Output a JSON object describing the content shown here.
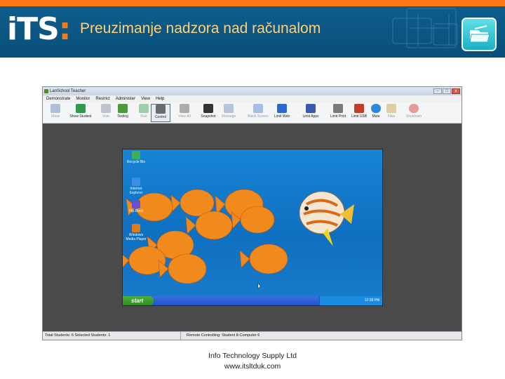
{
  "header": {
    "logo_text": "iTS",
    "logo_colon": ":",
    "title": "Preuzimanje nadzora nad računalom",
    "accent_color": "#ff7a14",
    "band_color": "#0d5f8f",
    "title_color": "#ffd27a",
    "corner_icon": "folder-icon"
  },
  "window": {
    "title": "LanSchool Teacher",
    "buttons": {
      "minimize": "–",
      "maximize": "□",
      "close": "x"
    },
    "menu": [
      "Demonstrate",
      "Monitor",
      "Restrict",
      "Administer",
      "View",
      "Help"
    ],
    "toolbar": [
      {
        "label": "Show",
        "icon": "monitor-icon",
        "enabled": false
      },
      {
        "label": "Show Student",
        "icon": "student-icon",
        "enabled": true
      },
      {
        "label": "Vote",
        "icon": "vote-icon",
        "enabled": false
      },
      {
        "label": "Testing",
        "icon": "testing-icon",
        "enabled": true
      },
      {
        "label": "Run",
        "icon": "run-icon",
        "enabled": false
      },
      {
        "label": "Control",
        "icon": "pen-icon",
        "enabled": true,
        "selected": true
      },
      {
        "label": "View All",
        "icon": "grid-icon",
        "enabled": false
      },
      {
        "label": "Snapshot",
        "icon": "camera-icon",
        "enabled": true
      },
      {
        "label": "Message",
        "icon": "message-icon",
        "enabled": false
      },
      {
        "label": "Blank Screen",
        "icon": "blank-screen-icon",
        "enabled": false
      },
      {
        "label": "Limit Web",
        "icon": "web-icon",
        "enabled": true
      },
      {
        "label": "Limit Apps",
        "icon": "apps-icon",
        "enabled": true
      },
      {
        "label": "Limit Print",
        "icon": "printer-icon",
        "enabled": true
      },
      {
        "label": "Limit USB",
        "icon": "usb-icon",
        "enabled": true
      },
      {
        "label": "Mute",
        "icon": "speaker-icon",
        "enabled": true
      },
      {
        "label": "Files",
        "icon": "files-icon",
        "enabled": false
      },
      {
        "label": "Shutdown",
        "icon": "shutdown-icon",
        "enabled": false
      }
    ],
    "status": {
      "left": "Total Students: 6  Selected Students: 1",
      "right": "Remote Controlling: Student 8-Computer 6"
    }
  },
  "desktop": {
    "icons": [
      {
        "label": "Recycle Bin",
        "icon": "recycle-bin-icon",
        "color": "#3fae5a"
      },
      {
        "label": "Internet Explorer",
        "icon": "internet-explorer-icon",
        "color": "#3a8ee6"
      },
      {
        "label": "Ftp.Rock",
        "icon": "ftp-icon",
        "color": "#6a4fd0"
      },
      {
        "label": "Windows Media Player",
        "icon": "media-player-icon",
        "color": "#e07a1a"
      }
    ],
    "start_label": "start",
    "clock": "12:38 PM"
  },
  "footer": {
    "line1": "Info Technology Supply Ltd",
    "line2": "www.itsltduk.com"
  }
}
